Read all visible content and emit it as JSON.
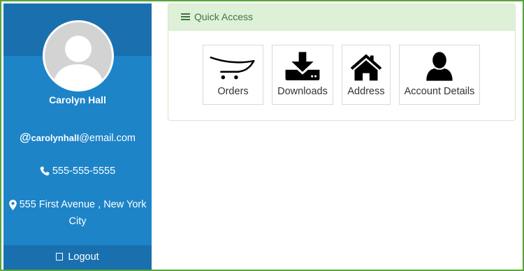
{
  "sidebar": {
    "user_name": "Carolyn Hall",
    "email_user": "carolynhall",
    "email_domain": "@email.com",
    "phone": "555-555-5555",
    "address": "555 First Avenue , New York City",
    "logout_label": "Logout",
    "icons": {
      "email": "at-icon",
      "phone": "phone-icon",
      "address": "map-marker-icon",
      "logout": "logout-icon"
    },
    "colors": {
      "background": "#1d84c8",
      "band": "#1a70ae"
    }
  },
  "panel": {
    "title": "Quick Access",
    "title_icon": "hamburger-icon",
    "colors": {
      "heading_bg": "#dff0d8",
      "heading_text": "#3c763d"
    },
    "tiles": [
      {
        "label": "Orders",
        "icon": "cart-icon"
      },
      {
        "label": "Downloads",
        "icon": "download-icon"
      },
      {
        "label": "Address",
        "icon": "home-icon"
      },
      {
        "label": "Account Details",
        "icon": "user-icon"
      }
    ]
  },
  "frame_color": "#57a53a"
}
